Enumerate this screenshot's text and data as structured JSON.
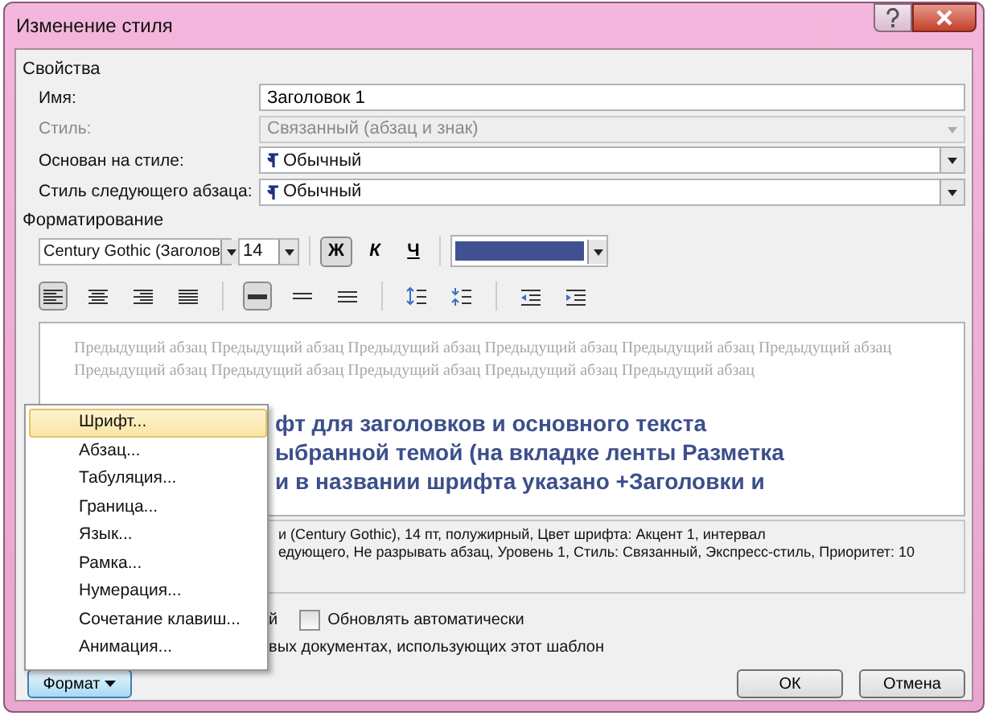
{
  "window": {
    "title": "Изменение стиля"
  },
  "properties": {
    "label": "Свойства",
    "rows": [
      {
        "label": "Имя:",
        "value": "Заголовок 1",
        "kind": "text",
        "disabled": false
      },
      {
        "label": "Стиль:",
        "value": "Связанный (абзац и знак)",
        "kind": "select",
        "disabled": true
      },
      {
        "label": "Основан на стиле:",
        "value": "Обычный",
        "kind": "style-select",
        "disabled": false
      },
      {
        "label": "Стиль следующего абзаца:",
        "value": "Обычный",
        "kind": "style-select",
        "disabled": false
      }
    ]
  },
  "formatting": {
    "label": "Форматирование",
    "font": "Century Gothic (Заголов",
    "size": "14",
    "styles": [
      {
        "kind": "bold",
        "label": "Ж",
        "selected": true
      },
      {
        "kind": "italic",
        "label": "К",
        "selected": false
      },
      {
        "kind": "underline",
        "label": "Ч",
        "selected": false
      }
    ],
    "font_color": {
      "color": "#3f5191"
    },
    "paragraph_buttons": [
      {
        "kind": "align-left",
        "selected": true
      },
      {
        "kind": "align-center",
        "selected": false
      },
      {
        "kind": "align-right",
        "selected": false
      },
      {
        "kind": "justify",
        "selected": false
      },
      {
        "kind": "spacing-single",
        "selected": true
      },
      {
        "kind": "spacing-half",
        "selected": false
      },
      {
        "kind": "spacing-double",
        "selected": false
      },
      {
        "kind": "space-before",
        "selected": false
      },
      {
        "kind": "space-after",
        "selected": false
      },
      {
        "kind": "indent-decrease",
        "selected": false
      },
      {
        "kind": "indent-increase",
        "selected": false
      }
    ]
  },
  "preview": {
    "previous": "Предыдущий абзац Предыдущий абзац Предыдущий абзац Предыдущий абзац Предыдущий абзац Предыдущий абзац Предыдущий абзац Предыдущий абзац Предыдущий абзац Предыдущий абзац Предыдущий абзац",
    "heading_lines": [
      "фт для заголовков и основного текста",
      "ыбранной темой (на вкладке ленты Разметка",
      "и в названии шрифта указано +Заголовки и"
    ]
  },
  "description": [
    "и (Century Gothic), 14 пт, полужирный, Цвет шрифта: Акцент 1, интервал",
    "едующего, Не разрывать абзац, Уровень 1, Стиль: Связанный, Экспресс-стиль, Приоритет: 10"
  ],
  "options": {
    "fragment": "й",
    "auto_update": {
      "label": "Обновлять автоматически",
      "checked": false
    },
    "template_note": "вых документах, использующих этот шаблон"
  },
  "format_menu": {
    "items": [
      {
        "label": "Шрифт...",
        "selected": true
      },
      {
        "label": "Абзац...",
        "selected": false
      },
      {
        "label": "Табуляция...",
        "selected": false
      },
      {
        "label": "Граница...",
        "selected": false
      },
      {
        "label": "Язык...",
        "selected": false
      },
      {
        "label": "Рамка...",
        "selected": false
      },
      {
        "label": "Нумерация...",
        "selected": false
      },
      {
        "label": "Сочетание клавиш...",
        "selected": false
      },
      {
        "label": "Анимация...",
        "selected": false
      }
    ]
  },
  "buttons": {
    "format": "Формат",
    "ok": "ОК",
    "cancel": "Отмена"
  }
}
